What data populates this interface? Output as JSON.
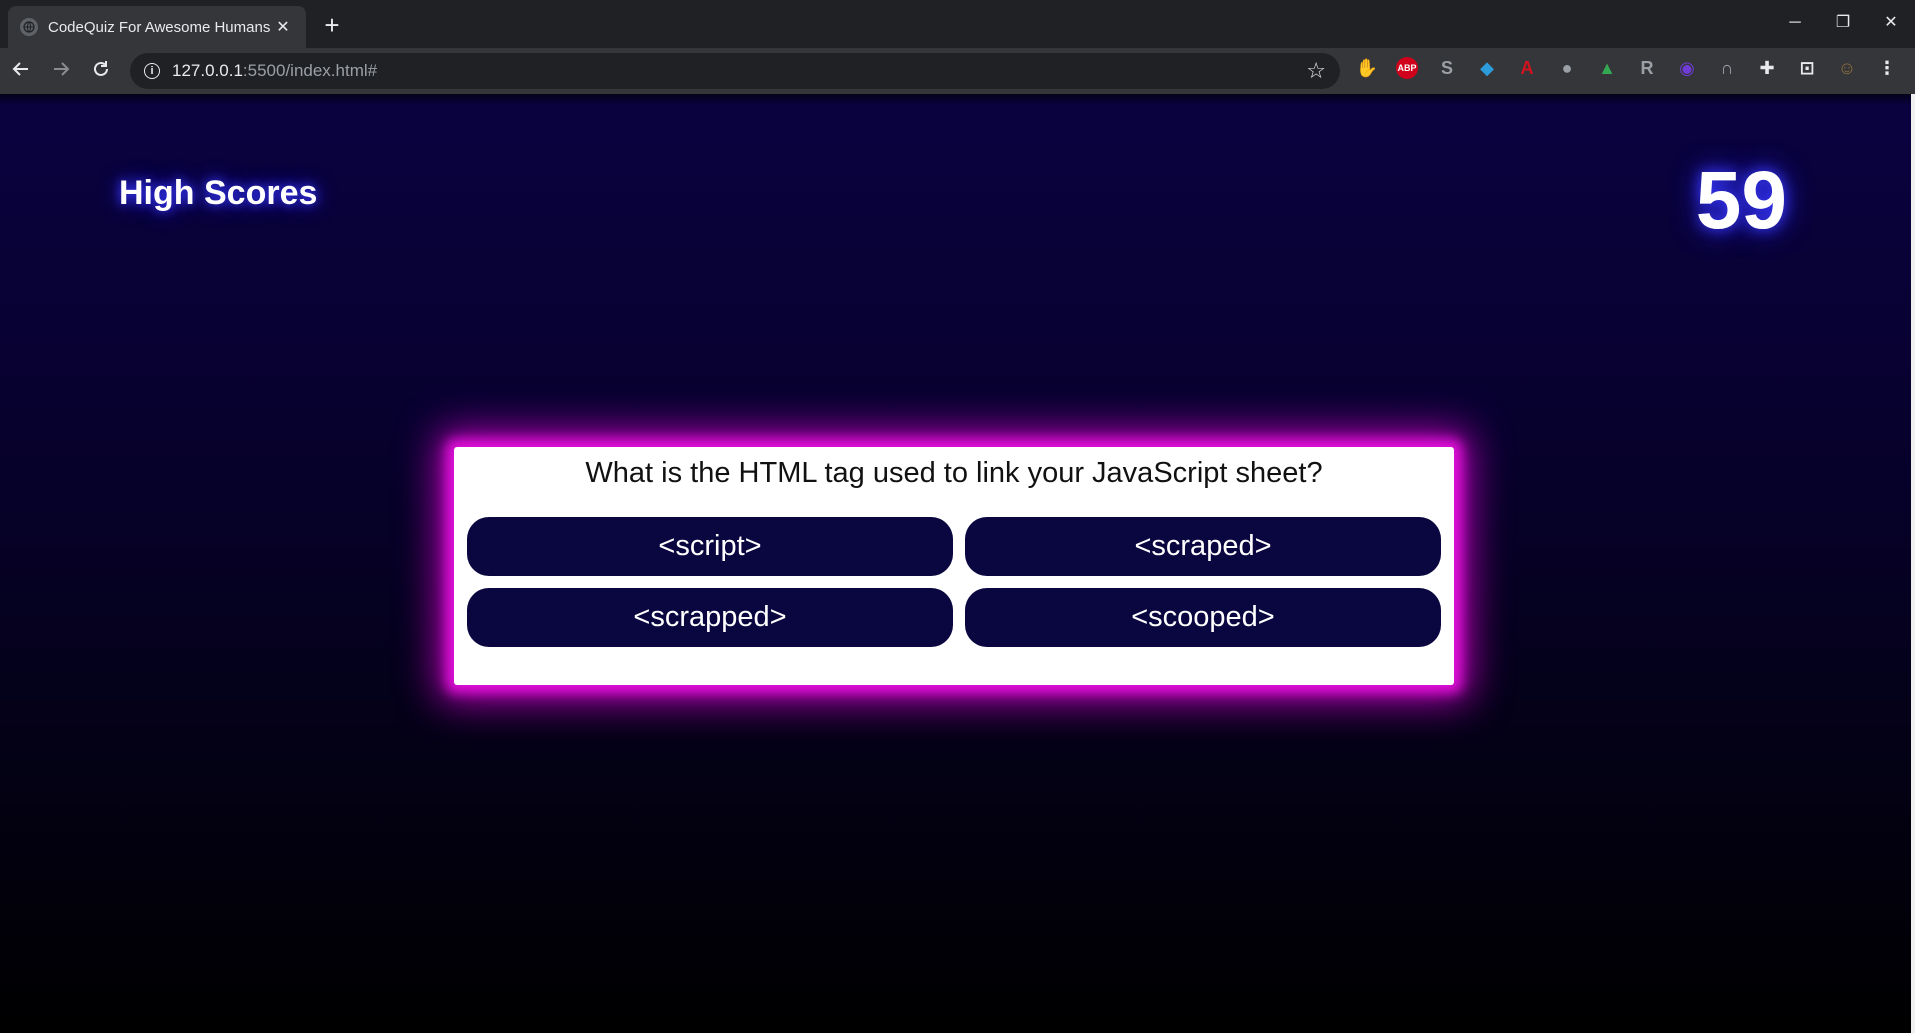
{
  "browser": {
    "tab_title": "CodeQuiz For Awesome Humans",
    "tab_close": "✕",
    "new_tab": "+",
    "url_host": "127.0.0.1",
    "url_rest": ":5500/index.html#",
    "window_controls": {
      "minimize": "─",
      "restore": "❐",
      "close": "✕"
    },
    "extensions": [
      {
        "name": "adblock-icon",
        "glyph": "✋",
        "color": "#e31b23"
      },
      {
        "name": "abp-icon",
        "glyph": "ABP",
        "color": "#d0021b"
      },
      {
        "name": "skype-icon",
        "glyph": "S",
        "color": "#9aa0a6"
      },
      {
        "name": "gem-icon",
        "glyph": "◆",
        "color": "#2d9cdb"
      },
      {
        "name": "acrobat-icon",
        "glyph": "A",
        "color": "#d3131d"
      },
      {
        "name": "speech-bubble-icon",
        "glyph": "●",
        "color": "#9aa0a6"
      },
      {
        "name": "drive-icon",
        "glyph": "▲",
        "color": "#34a853"
      },
      {
        "name": "r-extension-icon",
        "glyph": "R",
        "color": "#9aa0a6"
      },
      {
        "name": "purple-extension-icon",
        "glyph": "◉",
        "color": "#6f3cd6"
      },
      {
        "name": "arch-extension-icon",
        "glyph": "∩",
        "color": "#9aa0a6"
      },
      {
        "name": "puzzle-icon",
        "glyph": "✚",
        "color": "#e8eaed"
      },
      {
        "name": "cast-icon",
        "glyph": "⊡",
        "color": "#e8eaed"
      },
      {
        "name": "profile-avatar-icon",
        "glyph": "☺",
        "color": "#8a6d3b"
      },
      {
        "name": "menu-dots-icon",
        "glyph": "⋮",
        "color": "#e8eaed"
      }
    ]
  },
  "page": {
    "highscores_link": "High Scores",
    "timer": "59",
    "question": "What is the HTML tag used to link your JavaScript sheet?",
    "answers": [
      "<script>",
      "<scraped>",
      "<scrapped>",
      "<scooped>"
    ],
    "colors": {
      "glow": "#e010d8",
      "button_bg": "#0a0640",
      "page_top": "#0a0240"
    }
  }
}
